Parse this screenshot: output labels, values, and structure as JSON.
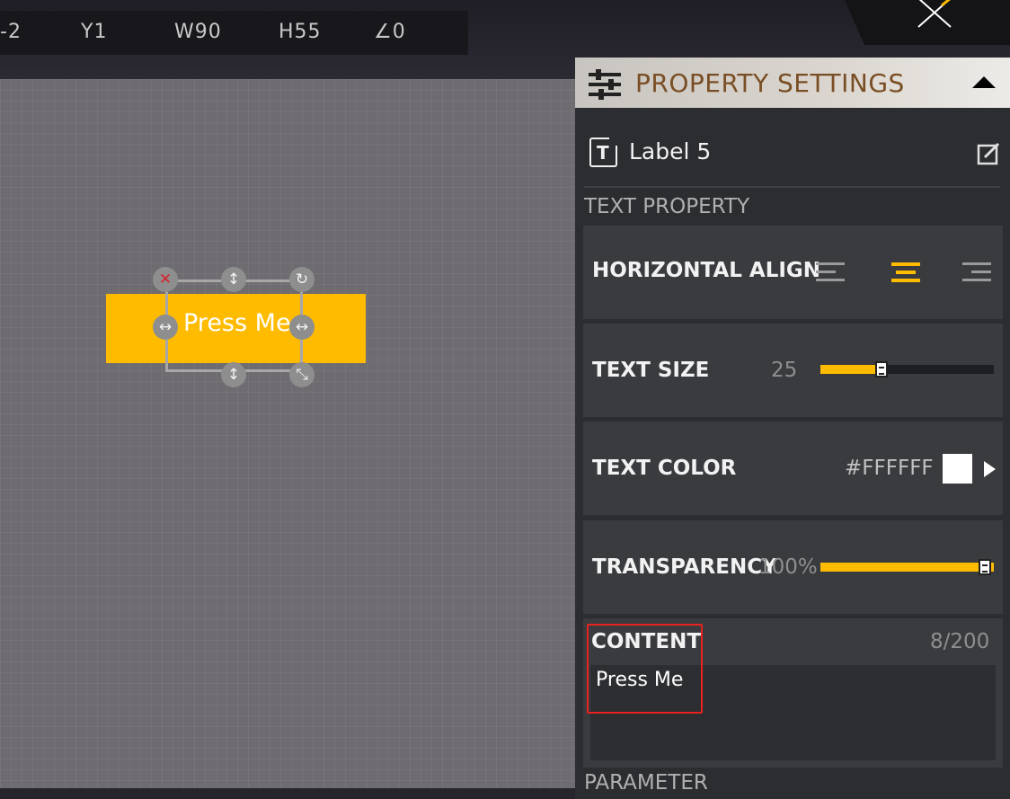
{
  "toolbar": {
    "x": "-2",
    "y": "Y1",
    "w": "W90",
    "h": "H55",
    "angle": "∠0"
  },
  "canvas": {
    "widget_text": "Press Me",
    "accent": "#ffbb00"
  },
  "panel": {
    "title": "PROPERTY SETTINGS",
    "selected_label": "Label 5",
    "text_property_title": "TEXT PROPERTY",
    "horizontal_align": {
      "label": "HORIZONTAL ALIGN",
      "selected": "center"
    },
    "text_size": {
      "label": "TEXT SIZE",
      "value": "25",
      "fraction": 0.35
    },
    "text_color": {
      "label": "TEXT COLOR",
      "value": "#FFFFFF"
    },
    "transparency": {
      "label": "TRANSPARENCY",
      "value": "100%",
      "fraction": 1.0
    },
    "content": {
      "label": "CONTENT",
      "count": "8/200",
      "value": "Press Me"
    },
    "parameter_title": "PARAMETER"
  },
  "icons": {
    "close": "close-icon",
    "sliders": "sliders-icon",
    "collapse": "triangle-up-icon",
    "text_type": "text-box-icon",
    "edit": "edit-icon"
  }
}
